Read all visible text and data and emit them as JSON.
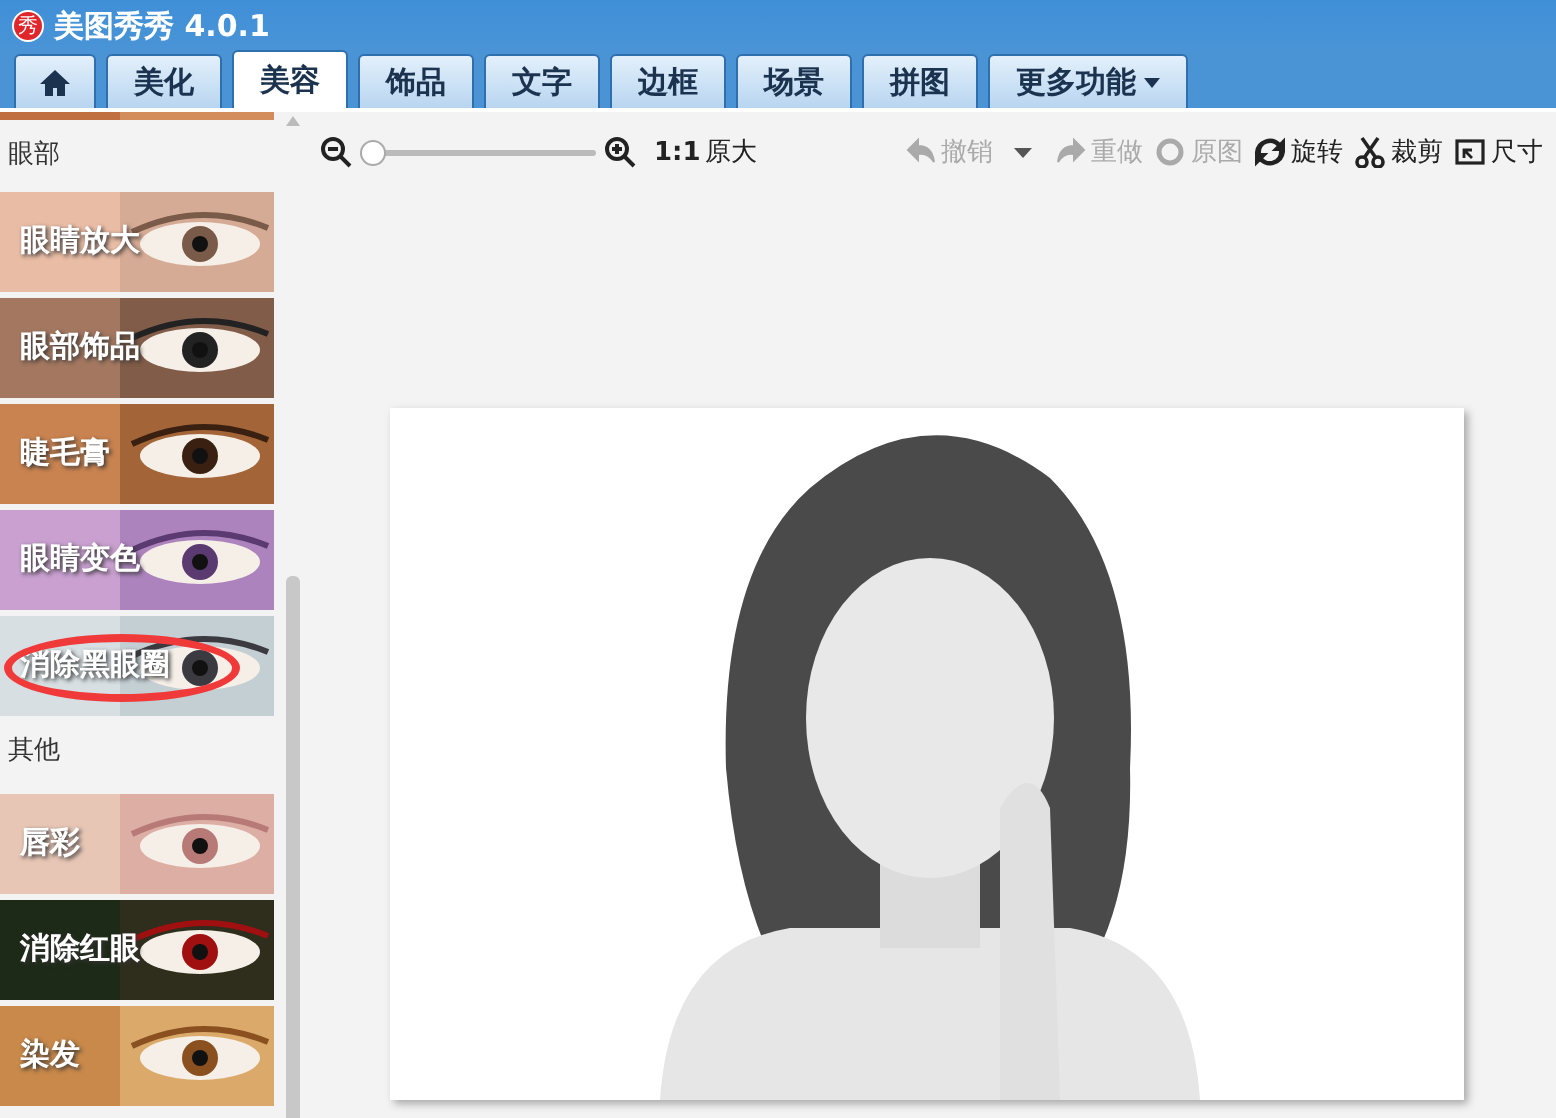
{
  "window": {
    "title": "美图秀秀 4.0.1",
    "logo": "秀"
  },
  "tabs": [
    {
      "kind": "home",
      "selected": false
    },
    {
      "label": "美化",
      "kind": "text",
      "selected": false
    },
    {
      "label": "美容",
      "kind": "text",
      "selected": true
    },
    {
      "label": "饰品",
      "kind": "text",
      "selected": false
    },
    {
      "label": "文字",
      "kind": "text",
      "selected": false
    },
    {
      "label": "边框",
      "kind": "text",
      "selected": false
    },
    {
      "label": "场景",
      "kind": "text",
      "selected": false
    },
    {
      "label": "拼图",
      "kind": "text",
      "selected": false
    },
    {
      "label": "更多功能",
      "kind": "menu",
      "selected": false
    }
  ],
  "sidebar": {
    "sections": [
      {
        "title": "眼部",
        "items": [
          {
            "label": "眼睛放大",
            "circled": false
          },
          {
            "label": "眼部饰品",
            "circled": false
          },
          {
            "label": "睫毛膏",
            "circled": false
          },
          {
            "label": "眼睛变色",
            "circled": false
          },
          {
            "label": "消除黑眼圈",
            "circled": true
          }
        ]
      },
      {
        "title": "其他",
        "items": [
          {
            "label": "唇彩",
            "circled": false
          },
          {
            "label": "消除红眼",
            "circled": false
          },
          {
            "label": "染发",
            "circled": false
          }
        ]
      }
    ]
  },
  "toolbar": {
    "zoom": {
      "level": 0
    },
    "actual_size": {
      "ratio": "1:1",
      "label": "原大"
    },
    "actions": [
      {
        "label": "撤销",
        "disabled": true,
        "dropdown": true
      },
      {
        "label": "重做",
        "disabled": true,
        "dropdown": false
      },
      {
        "label": "原图",
        "disabled": true,
        "dropdown": false
      },
      {
        "label": "旋转",
        "disabled": false,
        "dropdown": false
      },
      {
        "label": "裁剪",
        "disabled": false,
        "dropdown": false
      },
      {
        "label": "尺寸",
        "disabled": false,
        "dropdown": false
      }
    ]
  }
}
